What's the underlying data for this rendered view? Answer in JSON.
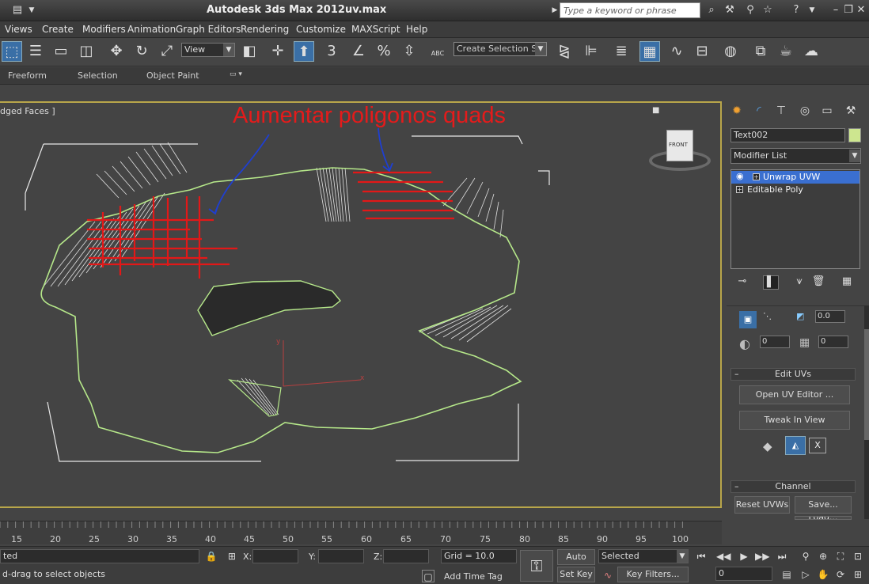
{
  "titlebar": {
    "app_title": "Autodesk 3ds Max  2012",
    "file_name": "uv.max",
    "search_placeholder": "Type a keyword or phrase"
  },
  "menu": [
    "Views",
    "Create",
    "Modifiers",
    "Animation",
    "Graph Editors",
    "Rendering",
    "Customize",
    "MAXScript",
    "Help"
  ],
  "toolbar": {
    "view_dropdown": "View",
    "snap_labels": [
      "3",
      "%"
    ],
    "selection_set": "Create Selection Se",
    "abc_label": "ABC"
  },
  "ribbon": {
    "tabs": [
      "Freeform",
      "Selection",
      "Object Paint"
    ]
  },
  "viewport": {
    "label": "dged Faces ]",
    "annotation": "Aumentar poligonos quads",
    "viewcube_face": "FRONT",
    "axis_x": "x",
    "axis_y": "y"
  },
  "command_panel": {
    "object_name": "Text002",
    "modifier_list": "Modifier List",
    "stack": [
      "Unwrap UVW",
      "Editable Poly"
    ],
    "spinners": [
      "0.0",
      "0",
      "0"
    ],
    "edit_uvs_header": "Edit UVs",
    "open_uv_editor": "Open UV Editor ...",
    "tweak_in_view": "Tweak In View",
    "channel_header": "Channel",
    "reset_uvws": "Reset UVWs",
    "save": "Save...",
    "load": "Load...",
    "x_button": "X"
  },
  "timeline": {
    "ticks": [
      "15",
      "20",
      "25",
      "30",
      "35",
      "40",
      "45",
      "50",
      "55",
      "60",
      "65",
      "70",
      "75",
      "80",
      "85",
      "90",
      "95",
      "100"
    ]
  },
  "statusbar": {
    "selected_text": "ted",
    "prompt": "d-drag to select objects",
    "x_label": "X:",
    "y_label": "Y:",
    "z_label": "Z:",
    "grid": "Grid = 10.0",
    "add_time_tag": "Add Time Tag",
    "auto_key": "Auto Key",
    "set_key": "Set Key",
    "key_mode": "Selected",
    "key_filters": "Key Filters...",
    "frame": "0"
  }
}
